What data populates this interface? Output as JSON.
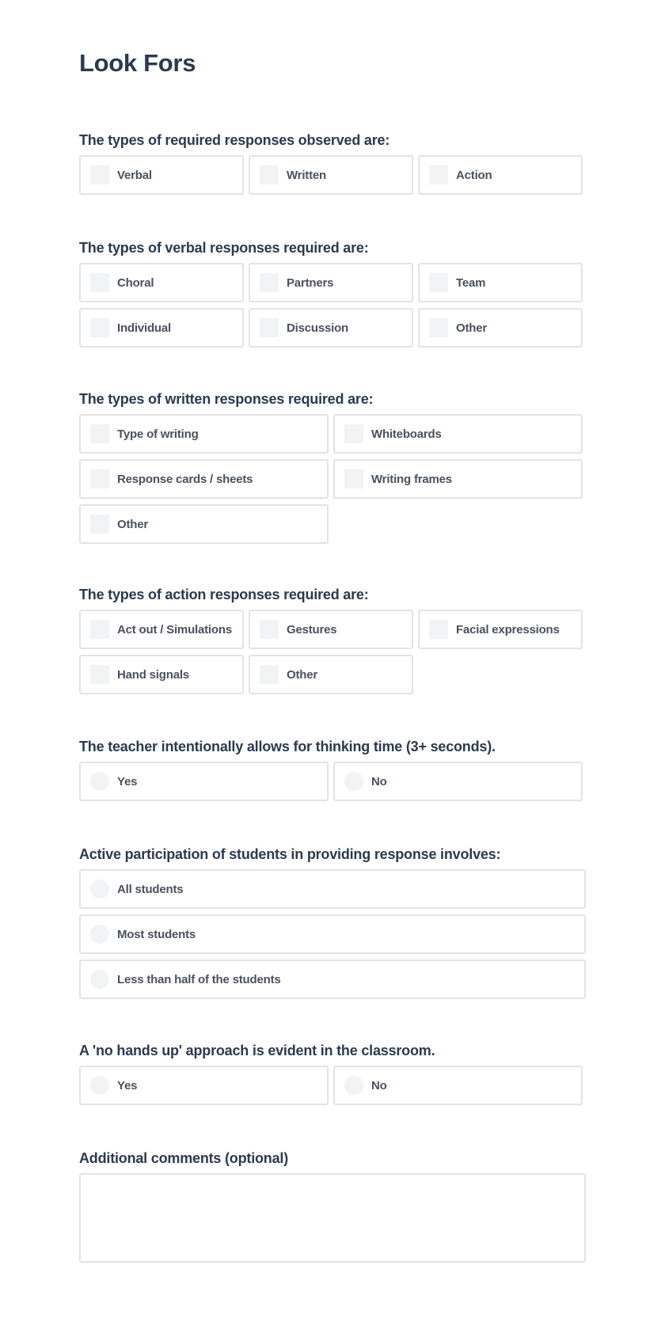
{
  "page": {
    "title": "Look Fors"
  },
  "colors": {
    "heading": "#2b3a4f",
    "label": "#4a515e",
    "border": "#e2e3e5",
    "control_fill": "#f2f3f5"
  },
  "questions": [
    {
      "heading": "The types of required responses observed are:",
      "type": "checkbox",
      "options": [
        {
          "label": "Verbal",
          "checked": false
        },
        {
          "label": "Written",
          "checked": false
        },
        {
          "label": "Action",
          "checked": false
        }
      ]
    },
    {
      "heading": "The types of verbal responses required are:",
      "type": "checkbox",
      "options": [
        {
          "label": "Choral",
          "checked": false
        },
        {
          "label": "Partners",
          "checked": false
        },
        {
          "label": "Team",
          "checked": false
        },
        {
          "label": "Individual",
          "checked": false
        },
        {
          "label": "Discussion",
          "checked": false
        },
        {
          "label": "Other",
          "checked": false
        }
      ]
    },
    {
      "heading": "The types of written responses required are:",
      "type": "checkbox",
      "options": [
        {
          "label": "Type of writing",
          "checked": false
        },
        {
          "label": "Whiteboards",
          "checked": false
        },
        {
          "label": "Response cards / sheets",
          "checked": false
        },
        {
          "label": "Writing frames",
          "checked": false
        },
        {
          "label": "Other",
          "checked": false
        }
      ]
    },
    {
      "heading": "The types of action responses required are:",
      "type": "checkbox",
      "options": [
        {
          "label": "Act out / Simulations",
          "checked": false
        },
        {
          "label": "Gestures",
          "checked": false
        },
        {
          "label": "Facial expressions",
          "checked": false
        },
        {
          "label": "Hand signals",
          "checked": false
        },
        {
          "label": "Other",
          "checked": false
        }
      ]
    },
    {
      "heading": "The teacher intentionally allows for thinking time (3+ seconds).",
      "type": "radio",
      "options": [
        {
          "label": "Yes",
          "selected": false
        },
        {
          "label": "No",
          "selected": false
        }
      ]
    },
    {
      "heading": "Active participation of students in providing response involves:",
      "type": "radio",
      "options": [
        {
          "label": "All students",
          "selected": false
        },
        {
          "label": "Most students",
          "selected": false
        },
        {
          "label": "Less than half of the students",
          "selected": false
        }
      ]
    },
    {
      "heading": "A 'no hands up' approach is evident in the classroom.",
      "type": "radio",
      "options": [
        {
          "label": "Yes",
          "selected": false
        },
        {
          "label": "No",
          "selected": false
        }
      ]
    }
  ],
  "comments": {
    "heading": "Additional comments (optional)",
    "value": "",
    "placeholder": ""
  }
}
